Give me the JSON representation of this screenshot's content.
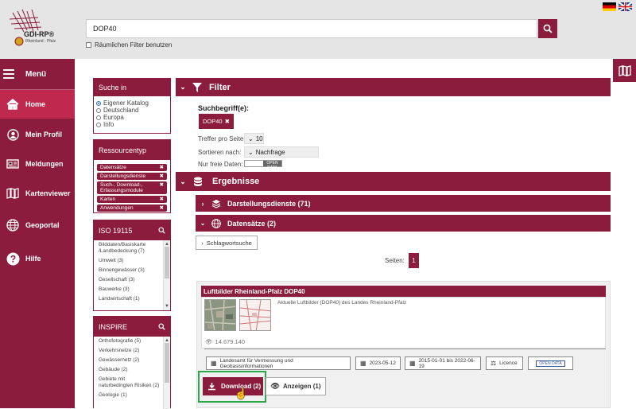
{
  "header": {
    "logo_title": "GDI-RP®",
    "logo_subtitle": "Rheinland - Pfalz",
    "search_value": "DOP40",
    "spatial_filter_label": "Räumlichen Filter benutzen"
  },
  "sidebar": {
    "menu_label": "Menü",
    "items": [
      {
        "label": "Home",
        "icon": "home-icon"
      },
      {
        "label": "Mein Profil",
        "icon": "user-icon"
      },
      {
        "label": "Meldungen",
        "icon": "newspaper-icon"
      },
      {
        "label": "Kartenviewer",
        "icon": "map-icon"
      },
      {
        "label": "Geoportal",
        "icon": "globe-icon"
      },
      {
        "label": "Hilfe",
        "icon": "help-icon"
      }
    ]
  },
  "search_in": {
    "title": "Suche in",
    "options": [
      "Eigener Katalog",
      "Deutschland",
      "Europa",
      "Info"
    ],
    "selected": "Eigener Katalog"
  },
  "resource_type": {
    "title": "Ressourcentyp",
    "tags": [
      "Datensätze",
      "Darstellungsdienste",
      "Such-, Download-, Erfassungsmodule",
      "Karten",
      "Anwendungen"
    ]
  },
  "iso": {
    "title": "ISO 19115",
    "items": [
      "Bilddaten/Basiskarte /Landbedeckung (7)",
      "Umwelt (3)",
      "Binnengewässer (3)",
      "Gesellschaft (3)",
      "Bauwerke (3)",
      "Landwirtschaft (1)"
    ]
  },
  "inspire": {
    "title": "INSPIRE",
    "items": [
      "Orthofotografie (5)",
      "Verkehrsnetze (2)",
      "Gewässernetz (2)",
      "Gebäude (2)",
      "Gebiete mit naturbedingten Risiken (2)",
      "Geologie (1)"
    ]
  },
  "filter": {
    "title": "Filter",
    "term_label": "Suchbegriff(e):",
    "term_chip": "DOP40",
    "per_page_label": "Treffer pro Seite:",
    "per_page_value": "10",
    "sort_label": "Sortieren nach:",
    "sort_value": "Nachfrage",
    "free_label": "Nur freie Daten:",
    "open_data_badge": "OPEN DATA"
  },
  "results": {
    "title": "Ergebnisse",
    "sections": [
      "Darstellungsdienste (71)",
      "Datensätze (2)"
    ],
    "keyword_button": "Schlagwortsuche",
    "pages_label": "Seiten:",
    "current_page": "1"
  },
  "card": {
    "title": "Luftbilder Rheinland-Pfalz DOP40",
    "description": "Aktuelle Luftbilder (DOP40) des Landes Rheinland-Pfalz",
    "views": "14.679.140",
    "org": "Landesamt für Vermessung und Geobasisinformationen",
    "date": "2023-05-12",
    "range": "2015-01-01 bis 2022-06-19",
    "licence": "Licence",
    "open_data": "OPEN DATA",
    "download": "Download (2)",
    "view": "Anzeigen (1)"
  },
  "colors": {
    "brand": "#8b1c3d",
    "highlight": "#2aa84a"
  }
}
